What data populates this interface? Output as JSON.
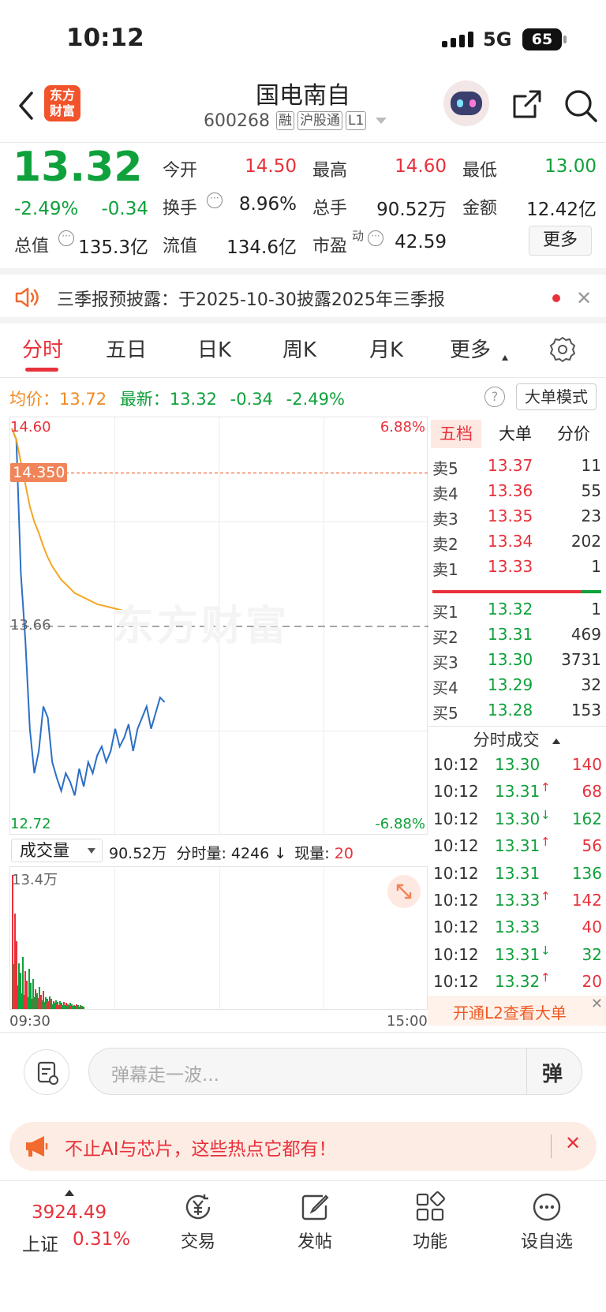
{
  "status": {
    "time": "10:12",
    "network": "5G",
    "battery": "65"
  },
  "header": {
    "logo_line1": "东方",
    "logo_line2": "财富",
    "stock_name": "国电南自",
    "stock_code": "600268",
    "tags": [
      "融",
      "沪股通",
      "L1"
    ]
  },
  "quote": {
    "price": "13.32",
    "change_pct": "-2.49%",
    "change": "-0.34",
    "fields": {
      "open_label": "今开",
      "open": "14.50",
      "high_label": "最高",
      "high": "14.60",
      "low_label": "最低",
      "low": "13.00",
      "turnover_label": "换手",
      "turnover": "8.96%",
      "volume_label": "总手",
      "volume": "90.52万",
      "amount_label": "金额",
      "amount": "12.42亿",
      "mktcap_label": "总值",
      "mktcap": "135.3亿",
      "float_label": "流值",
      "float": "134.6亿",
      "pe_label": "市盈",
      "pe_sup": "动",
      "pe": "42.59",
      "more": "更多"
    }
  },
  "notice": {
    "text": "三季报预披露：于2025-10-30披露2025年三季报"
  },
  "tabs": [
    "分时",
    "五日",
    "日K",
    "周K",
    "月K",
    "更多"
  ],
  "summary": {
    "avg_label": "均价：",
    "avg": "13.72",
    "last_label": "最新：",
    "last": "13.32",
    "change": "-0.34",
    "change_pct": "-2.49%",
    "big_mode": "大单模式"
  },
  "chart_labels": {
    "top_price": "14.60",
    "top_pct": "6.88%",
    "mid_price": "13.66",
    "bottom_price": "12.72",
    "bottom_pct": "-6.88%",
    "marker": "14.350",
    "watermark": "东方财富"
  },
  "chart_data": {
    "type": "line",
    "ylim": [
      12.72,
      14.6
    ],
    "prev_close": 13.66,
    "marker_price": 14.35,
    "series": [
      {
        "name": "price",
        "color": "#2c6fc4",
        "values": [
          14.55,
          14.5,
          13.9,
          13.6,
          13.2,
          13.0,
          13.1,
          13.3,
          13.25,
          13.05,
          12.98,
          12.92,
          13.0,
          12.96,
          12.9,
          13.02,
          12.94,
          13.05,
          13.0,
          13.08,
          13.12,
          13.05,
          13.1,
          13.2,
          13.12,
          13.16,
          13.22,
          13.1,
          13.2,
          13.25,
          13.3,
          13.2,
          13.27,
          13.34,
          13.32
        ]
      },
      {
        "name": "avg",
        "color": "#f5a623",
        "values": [
          14.55,
          14.5,
          14.4,
          14.3,
          14.2,
          14.13,
          14.08,
          14.02,
          13.97,
          13.93,
          13.9,
          13.87,
          13.85,
          13.83,
          13.81,
          13.8,
          13.79,
          13.78,
          13.77,
          13.76,
          13.755,
          13.75,
          13.745,
          13.74,
          13.735,
          13.73,
          13.728,
          13.726,
          13.724,
          13.722,
          13.72
        ]
      }
    ],
    "volume": {
      "max_label": "13.4万",
      "values": [
        13.4,
        4.5,
        9.5,
        3.2,
        6.8,
        2.4,
        4.6,
        2.0,
        3.6,
        1.6,
        5.2,
        1.4,
        3.8,
        1.8,
        2.8,
        1.2,
        4.0,
        1.4,
        2.6,
        1.0,
        3.0,
        1.2,
        2.0,
        0.9,
        1.6,
        1.1,
        2.2,
        0.8,
        1.4,
        0.9,
        1.8,
        0.7,
        1.2,
        0.6,
        1.0,
        0.8,
        1.3,
        0.6,
        1.0,
        0.5,
        0.8,
        0.6,
        0.9,
        0.5,
        0.7,
        0.4,
        0.8,
        0.5,
        0.6,
        0.4,
        0.7,
        0.4,
        0.6,
        0.3,
        0.5,
        0.4,
        0.6,
        0.3,
        0.5,
        0.3,
        0.4,
        0.3,
        0.5,
        0.3,
        0.4,
        0.2,
        0.4,
        0.3,
        0.3,
        0.2
      ],
      "colors": [
        "r",
        "g",
        "r",
        "g",
        "r",
        "g",
        "g",
        "r",
        "g",
        "r",
        "g",
        "r",
        "r",
        "g",
        "r",
        "g",
        "g",
        "r",
        "g",
        "r",
        "g",
        "g",
        "r",
        "r",
        "g",
        "r",
        "g",
        "g",
        "r",
        "g",
        "r",
        "g",
        "g",
        "r",
        "g",
        "r",
        "g",
        "g",
        "r",
        "g",
        "r",
        "g",
        "g",
        "r",
        "g",
        "r",
        "g",
        "r",
        "g",
        "g",
        "r",
        "g",
        "r",
        "g",
        "g",
        "r",
        "g",
        "r",
        "g",
        "g",
        "r",
        "g",
        "r",
        "g",
        "g",
        "r",
        "g",
        "r",
        "g",
        "g"
      ]
    },
    "x_start": "09:30",
    "x_end": "15:00"
  },
  "volume_bar": {
    "selector": "成交量",
    "total": "90.52万",
    "min_label": "分时量:",
    "min_val": "4246",
    "cur_label": "现量:",
    "cur_val": "20"
  },
  "orderbook": {
    "tabs": [
      "五档",
      "大单",
      "分价"
    ],
    "sell": [
      {
        "label": "卖5",
        "price": "13.37",
        "vol": "11"
      },
      {
        "label": "卖4",
        "price": "13.36",
        "vol": "55"
      },
      {
        "label": "卖3",
        "price": "13.35",
        "vol": "23"
      },
      {
        "label": "卖2",
        "price": "13.34",
        "vol": "202"
      },
      {
        "label": "卖1",
        "price": "13.33",
        "vol": "1"
      }
    ],
    "buy": [
      {
        "label": "买1",
        "price": "13.32",
        "vol": "1"
      },
      {
        "label": "买2",
        "price": "13.31",
        "vol": "469"
      },
      {
        "label": "买3",
        "price": "13.30",
        "vol": "3731"
      },
      {
        "label": "买4",
        "price": "13.29",
        "vol": "32"
      },
      {
        "label": "买5",
        "price": "13.28",
        "vol": "153"
      }
    ]
  },
  "ticks": {
    "title": "分时成交",
    "rows": [
      {
        "time": "10:12",
        "price": "13.30",
        "arrow": "",
        "vol": "140",
        "dir": "r"
      },
      {
        "time": "10:12",
        "price": "13.31",
        "arrow": "↑",
        "vol": "68",
        "dir": "r"
      },
      {
        "time": "10:12",
        "price": "13.30",
        "arrow": "↓",
        "vol": "162",
        "dir": "g"
      },
      {
        "time": "10:12",
        "price": "13.31",
        "arrow": "↑",
        "vol": "56",
        "dir": "r"
      },
      {
        "time": "10:12",
        "price": "13.31",
        "arrow": "",
        "vol": "136",
        "dir": "g"
      },
      {
        "time": "10:12",
        "price": "13.33",
        "arrow": "↑",
        "vol": "142",
        "dir": "r"
      },
      {
        "time": "10:12",
        "price": "13.33",
        "arrow": "",
        "vol": "40",
        "dir": "r"
      },
      {
        "time": "10:12",
        "price": "13.31",
        "arrow": "↓",
        "vol": "32",
        "dir": "g"
      },
      {
        "time": "10:12",
        "price": "13.32",
        "arrow": "↑",
        "vol": "20",
        "dir": "r"
      }
    ],
    "l2_banner": "开通L2查看大单"
  },
  "comment": {
    "placeholder": "弹幕走一波...",
    "danmu": "弹"
  },
  "promo": {
    "text": "不止AI与芯片，这些热点它都有！"
  },
  "bottom": {
    "index_value": "3924.49",
    "index_name": "上证",
    "index_pct": "0.31%",
    "items": [
      "交易",
      "发帖",
      "功能",
      "设自选"
    ]
  }
}
